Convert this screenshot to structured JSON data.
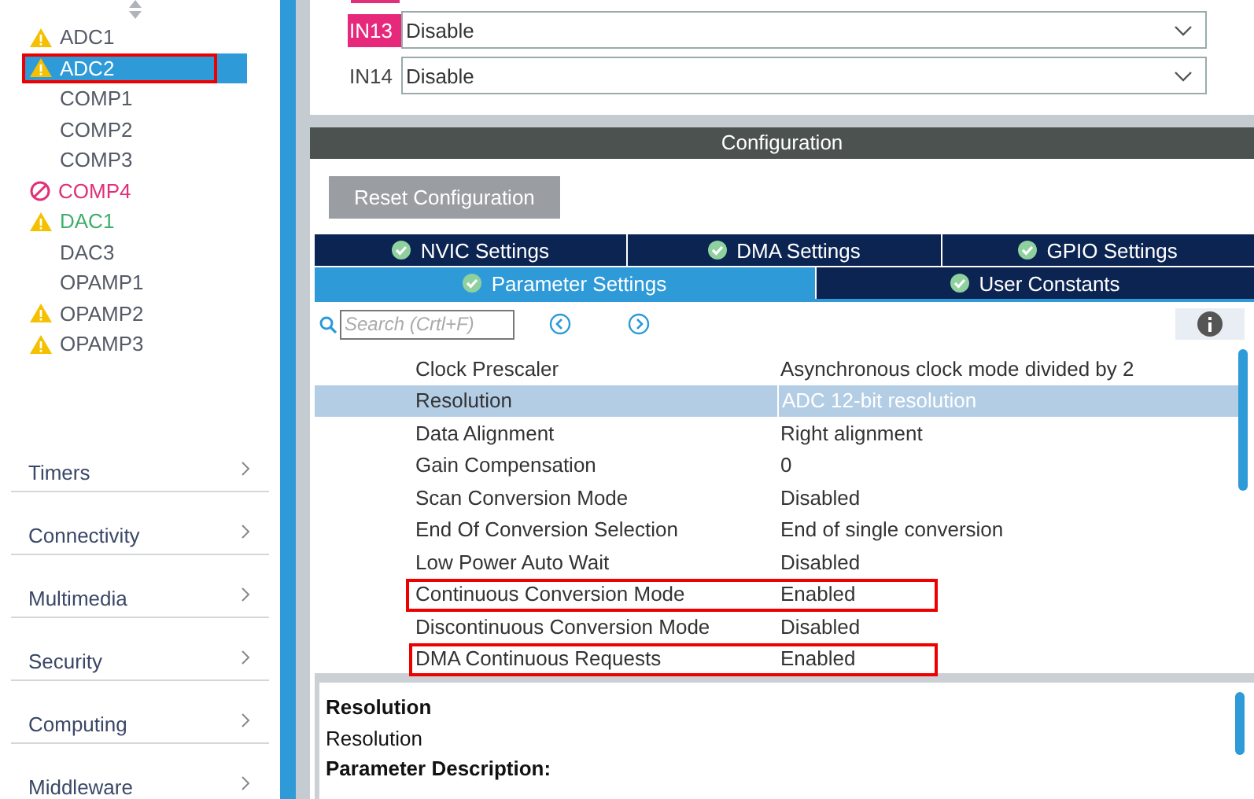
{
  "sidebar": {
    "items": [
      {
        "label": "ADC1",
        "kind": "warning",
        "selected": false,
        "highlighted": false
      },
      {
        "label": "ADC2",
        "kind": "warning",
        "selected": true,
        "highlighted": true
      },
      {
        "label": "COMP1",
        "kind": "plain",
        "selected": false,
        "highlighted": false
      },
      {
        "label": "COMP2",
        "kind": "plain",
        "selected": false,
        "highlighted": false
      },
      {
        "label": "COMP3",
        "kind": "plain",
        "selected": false,
        "highlighted": false
      },
      {
        "label": "COMP4",
        "kind": "error",
        "color": "#e0307a",
        "selected": false,
        "highlighted": false
      },
      {
        "label": "DAC1",
        "kind": "warning",
        "color": "#3fae6a",
        "selected": false,
        "highlighted": false
      },
      {
        "label": "DAC3",
        "kind": "plain",
        "selected": false,
        "highlighted": false
      },
      {
        "label": "OPAMP1",
        "kind": "plain",
        "selected": false,
        "highlighted": false
      },
      {
        "label": "OPAMP2",
        "kind": "warning",
        "selected": false,
        "highlighted": false
      },
      {
        "label": "OPAMP3",
        "kind": "warning",
        "selected": false,
        "highlighted": false
      }
    ],
    "categories": [
      "Timers",
      "Connectivity",
      "Multimedia",
      "Security",
      "Computing",
      "Middleware"
    ]
  },
  "inputs": [
    {
      "label": "IN13",
      "flagged": true,
      "value": "Disable"
    },
    {
      "label": "IN14",
      "flagged": false,
      "value": "Disable"
    }
  ],
  "configuration": {
    "title": "Configuration",
    "reset_button": "Reset Configuration",
    "tabs_row1": [
      {
        "label": "NVIC Settings",
        "selected": false
      },
      {
        "label": "DMA Settings",
        "selected": false
      },
      {
        "label": "GPIO Settings",
        "selected": false
      }
    ],
    "tabs_row2": [
      {
        "label": "Parameter Settings",
        "selected": true
      },
      {
        "label": "User Constants",
        "selected": false
      }
    ],
    "search": {
      "placeholder": "Search (Crtl+F)"
    },
    "parameters": [
      {
        "name": "Clock Prescaler",
        "value": "Asynchronous clock mode divided by 2",
        "selected": false,
        "highlighted": false
      },
      {
        "name": "Resolution",
        "value": "ADC 12-bit resolution",
        "selected": true,
        "highlighted": false
      },
      {
        "name": "Data Alignment",
        "value": "Right alignment",
        "selected": false,
        "highlighted": false
      },
      {
        "name": "Gain Compensation",
        "value": "0",
        "selected": false,
        "highlighted": false
      },
      {
        "name": "Scan Conversion Mode",
        "value": "Disabled",
        "selected": false,
        "highlighted": false
      },
      {
        "name": "End Of Conversion Selection",
        "value": "End of single conversion",
        "selected": false,
        "highlighted": false
      },
      {
        "name": "Low Power Auto Wait",
        "value": "Disabled",
        "selected": false,
        "highlighted": false
      },
      {
        "name": "Continuous Conversion Mode",
        "value": "Enabled",
        "selected": false,
        "highlighted": true
      },
      {
        "name": "Discontinuous Conversion Mode",
        "value": "Disabled",
        "selected": false,
        "highlighted": false
      },
      {
        "name": "DMA Continuous Requests",
        "value": "Enabled",
        "selected": false,
        "highlighted": true
      }
    ],
    "description": {
      "title": "Resolution",
      "subtitle": "Resolution",
      "heading": "Parameter Description:"
    }
  }
}
